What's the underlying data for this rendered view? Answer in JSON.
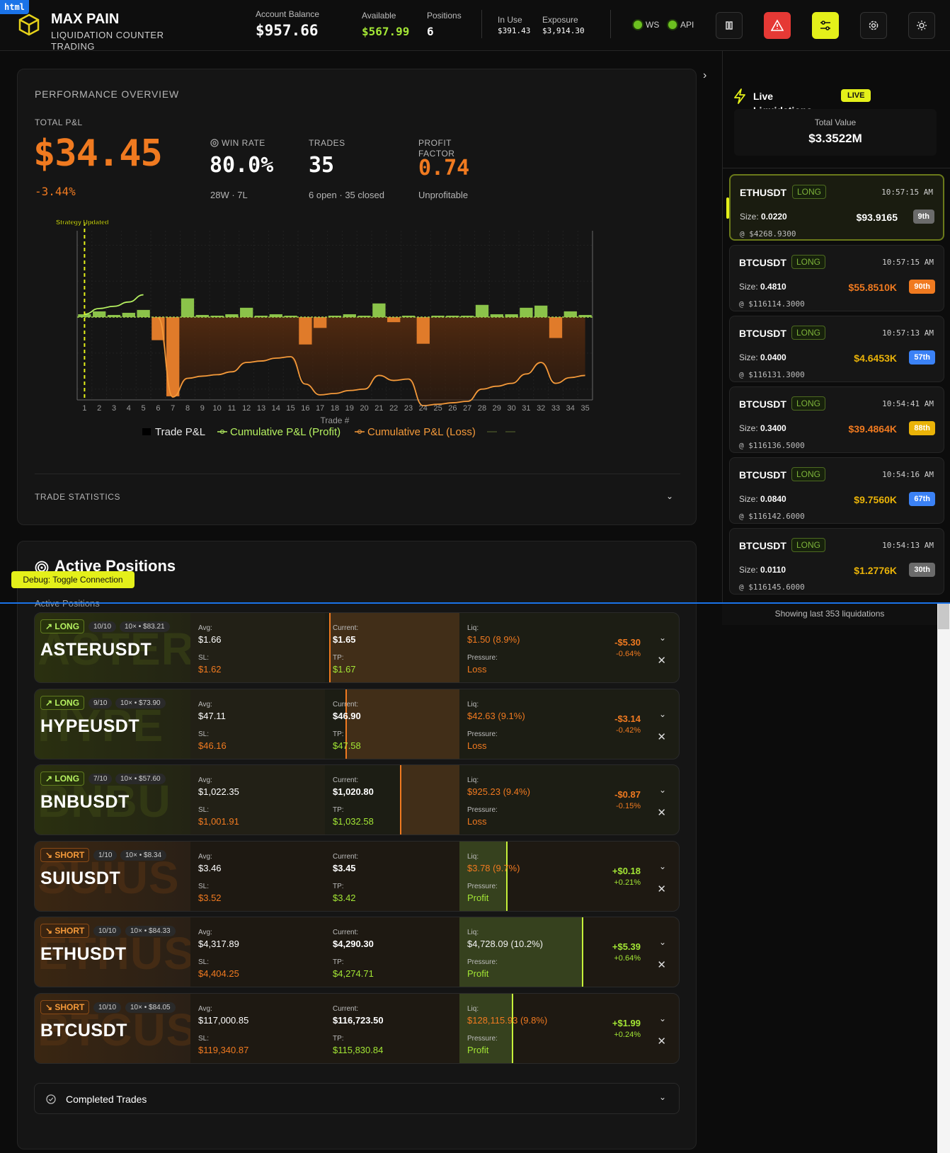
{
  "html_tag": "html",
  "brand": {
    "title": "MAX PAIN",
    "subtitle1": "LIQUIDATION COUNTER",
    "subtitle2": "TRADING"
  },
  "header": {
    "account_balance_label": "Account Balance",
    "account_balance": "$957.66",
    "available_label": "Available",
    "available": "$567.99",
    "positions_label": "Positions",
    "positions": "6",
    "in_use_label": "In Use",
    "in_use": "$391.43",
    "exposure_label": "Exposure",
    "exposure": "$3,914.30",
    "ws_label": "WS",
    "api_label": "API"
  },
  "performance": {
    "title": "PERFORMANCE OVERVIEW",
    "total_pnl_label": "TOTAL P&L",
    "total_pnl": "$34.45",
    "total_pnl_pct": "-3.44%",
    "win_rate_label": "WIN RATE",
    "win_rate": "80.0%",
    "win_rate_sub": "28W · 7L",
    "trades_label": "TRADES",
    "trades": "35",
    "trades_sub": "6 open · 35 closed",
    "pf_label1": "PROFIT",
    "pf_label2": "FACTOR",
    "profit_factor": "0.74",
    "pf_sub": "Unprofitable",
    "trade_stats": "TRADE STATISTICS"
  },
  "chart_data": {
    "type": "bar",
    "annotation": "Strategy Updated",
    "xlabel": "Trade #",
    "categories": [
      "1",
      "2",
      "3",
      "4",
      "5",
      "6",
      "7",
      "8",
      "9",
      "10",
      "11",
      "12",
      "13",
      "14",
      "15",
      "16",
      "17",
      "18",
      "19",
      "20",
      "21",
      "22",
      "23",
      "24",
      "25",
      "26",
      "27",
      "28",
      "29",
      "30",
      "31",
      "32",
      "33",
      "34",
      "35"
    ],
    "series": [
      {
        "name": "Trade P&L",
        "values": [
          0.4,
          0.8,
          0.3,
          0.6,
          1.0,
          -3.2,
          -11.0,
          2.6,
          0.3,
          0.2,
          0.4,
          1.3,
          0.2,
          0.4,
          0.2,
          -3.8,
          -1.5,
          0.2,
          0.4,
          0.2,
          1.9,
          -0.7,
          0.2,
          -3.7,
          0.2,
          0.2,
          0.2,
          1.7,
          0.4,
          0.4,
          1.3,
          1.6,
          -2.9,
          0.8,
          0.3
        ]
      },
      {
        "name": "Cumulative P&L (Profit)",
        "values": [
          0.4,
          1.2,
          1.5,
          2.1,
          3.1,
          null,
          null,
          null,
          null,
          null,
          null,
          null,
          null,
          null,
          null,
          null,
          null,
          null,
          null,
          null,
          null,
          null,
          null,
          null,
          null,
          null,
          null,
          null,
          null,
          null,
          null,
          null,
          null,
          null,
          null
        ]
      },
      {
        "name": "Cumulative P&L (Loss)",
        "values": [
          null,
          null,
          null,
          null,
          null,
          -0.1,
          -11.1,
          -8.5,
          -8.2,
          -8.0,
          -7.6,
          -6.3,
          -6.1,
          -5.7,
          -5.5,
          -9.3,
          -10.8,
          -10.6,
          -10.2,
          -10.0,
          -8.1,
          -8.8,
          -8.6,
          -12.3,
          -12.1,
          -11.9,
          -11.7,
          -10.0,
          -9.6,
          -9.2,
          -7.9,
          -6.3,
          -9.2,
          -8.4,
          -8.1
        ]
      }
    ],
    "ylim": [
      -11.5,
      12
    ],
    "grid": true,
    "legend_position": "bottom",
    "colors": {
      "profit": "#8bc34a",
      "loss": "#e07b2a",
      "profit_line": "#b6f261",
      "loss_line": "#f59a3a",
      "marker": "#e6f21a"
    }
  },
  "positions_section": {
    "title": "Active Positions",
    "subtitle": "Active Positions",
    "debug_label": "Debug: Toggle Connection",
    "completed_trades": "Completed Trades",
    "items": [
      {
        "dir": "LONG",
        "count": "10/10",
        "lev": "10× • $83.21",
        "name": "ASTERUSDT",
        "bg": "ASTER",
        "avg": "$1.66",
        "sl": "$1.62",
        "current": "$1.65",
        "tp": "$1.67",
        "liq": "$1.50 (8.9%)",
        "pressure": "Loss",
        "pnl": "-$5.30",
        "pnl_pct": "-0.64%"
      },
      {
        "dir": "LONG",
        "count": "9/10",
        "lev": "10× • $73.90",
        "name": "HYPEUSDT",
        "bg": "HYPE",
        "avg": "$47.11",
        "sl": "$46.16",
        "current": "$46.90",
        "tp": "$47.58",
        "liq": "$42.63 (9.1%)",
        "pressure": "Loss",
        "pnl": "-$3.14",
        "pnl_pct": "-0.42%"
      },
      {
        "dir": "LONG",
        "count": "7/10",
        "lev": "10× • $57.60",
        "name": "BNBUSDT",
        "bg": "BNBU",
        "avg": "$1,022.35",
        "sl": "$1,001.91",
        "current": "$1,020.80",
        "tp": "$1,032.58",
        "liq": "$925.23 (9.4%)",
        "pressure": "Loss",
        "pnl": "-$0.87",
        "pnl_pct": "-0.15%"
      },
      {
        "dir": "SHORT",
        "count": "1/10",
        "lev": "10× • $8.34",
        "name": "SUIUSDT",
        "bg": "SUIUS",
        "avg": "$3.46",
        "sl": "$3.52",
        "current": "$3.45",
        "tp": "$3.42",
        "liq": "$3.78 (9.7%)",
        "pressure": "Profit",
        "pnl": "+$0.18",
        "pnl_pct": "+0.21%"
      },
      {
        "dir": "SHORT",
        "count": "10/10",
        "lev": "10× • $84.33",
        "name": "ETHUSDT",
        "bg": "ETHUS",
        "avg": "$4,317.89",
        "sl": "$4,404.25",
        "current": "$4,290.30",
        "tp": "$4,274.71",
        "liq": "$4,728.09 (10.2%)",
        "pressure": "Profit",
        "pnl": "+$5.39",
        "pnl_pct": "+0.64%"
      },
      {
        "dir": "SHORT",
        "count": "10/10",
        "lev": "10× • $84.05",
        "name": "BTCUSDT",
        "bg": "BTCUS",
        "avg": "$117,000.85",
        "sl": "$119,340.87",
        "current": "$116,723.50",
        "tp": "$115,830.84",
        "liq": "$128,115.93 (9.8%)",
        "pressure": "Profit",
        "pnl": "+$1.99",
        "pnl_pct": "+0.24%"
      }
    ]
  },
  "sidebar": {
    "live_title1": "Live",
    "live_title2": "Liquidations",
    "live_badge": "LIVE",
    "total_value_label": "Total Value",
    "total_value": "$3.3522M",
    "footer": "Showing last 353 liquidations",
    "items": [
      {
        "symbol": "ETHUSDT",
        "side": "LONG",
        "time": "10:57:15 AM",
        "size": "0.0220",
        "usd": "$93.9165",
        "rank": "9th",
        "price": "@ $4268.9300"
      },
      {
        "symbol": "BTCUSDT",
        "side": "LONG",
        "time": "10:57:15 AM",
        "size": "0.4810",
        "usd": "$55.8510K",
        "rank": "90th",
        "price": "@ $116114.3000"
      },
      {
        "symbol": "BTCUSDT",
        "side": "LONG",
        "time": "10:57:13 AM",
        "size": "0.0400",
        "usd": "$4.6453K",
        "rank": "57th",
        "price": "@ $116131.3000"
      },
      {
        "symbol": "BTCUSDT",
        "side": "LONG",
        "time": "10:54:41 AM",
        "size": "0.3400",
        "usd": "$39.4864K",
        "rank": "88th",
        "price": "@ $116136.5000"
      },
      {
        "symbol": "BTCUSDT",
        "side": "LONG",
        "time": "10:54:16 AM",
        "size": "0.0840",
        "usd": "$9.7560K",
        "rank": "67th",
        "price": "@ $116142.6000"
      },
      {
        "symbol": "BTCUSDT",
        "side": "LONG",
        "time": "10:54:13 AM",
        "size": "0.0110",
        "usd": "$1.2776K",
        "rank": "30th",
        "price": "@ $116145.6000"
      }
    ]
  },
  "labels": {
    "size_prefix": "Size: ",
    "avg": "Avg:",
    "sl": "SL:",
    "current": "Current:",
    "tp": "TP:",
    "liq": "Liq:",
    "pressure": "Pressure:"
  }
}
